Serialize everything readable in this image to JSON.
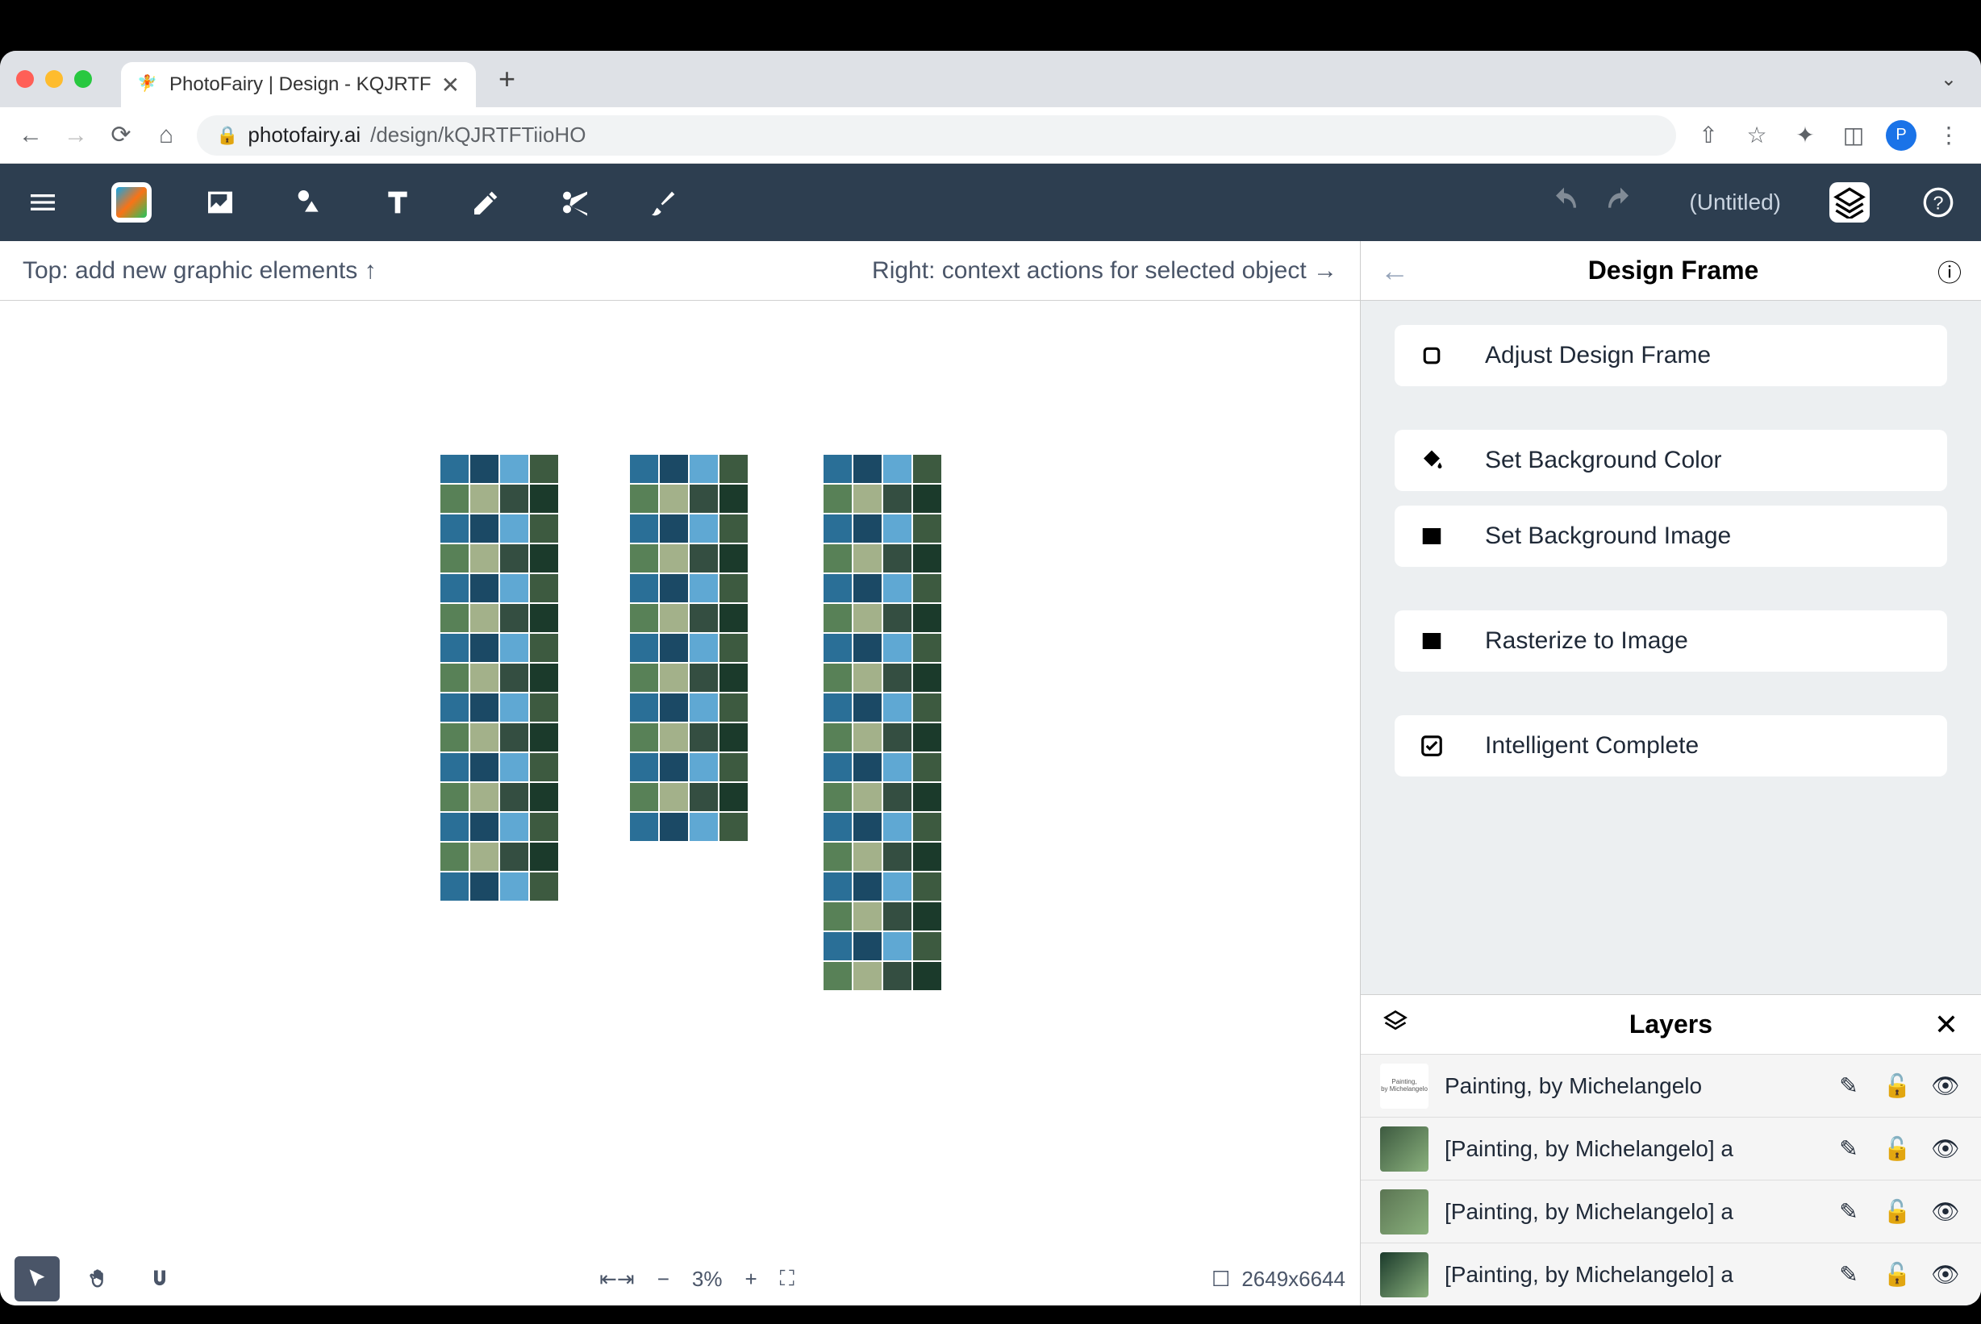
{
  "browser": {
    "tab_title": "PhotoFairy | Design - KQJRTF",
    "url_host": "photofairy.ai",
    "url_path": "/design/kQJRTFTiioHO",
    "avatar_letter": "P"
  },
  "toolbar": {
    "doc_title": "(Untitled)"
  },
  "hints": {
    "top": "Top: add new graphic elements ↑",
    "right": "Right: context actions for selected object →"
  },
  "right_panel": {
    "title": "Design Frame",
    "actions": {
      "adjust": "Adjust Design Frame",
      "bgcolor": "Set Background Color",
      "bgimage": "Set Background Image",
      "rasterize": "Rasterize to Image",
      "intelligent": "Intelligent Complete"
    }
  },
  "layers": {
    "title": "Layers",
    "items": [
      {
        "label": "Painting, by Michelangelo",
        "thumb_type": "text"
      },
      {
        "label": "[Painting, by Michelangelo] a",
        "thumb_type": "img"
      },
      {
        "label": "[Painting, by Michelangelo] a",
        "thumb_type": "img"
      },
      {
        "label": "[Painting, by Michelangelo] a",
        "thumb_type": "img"
      }
    ]
  },
  "bottom": {
    "zoom": "3%",
    "dimensions": "2649x6644"
  }
}
